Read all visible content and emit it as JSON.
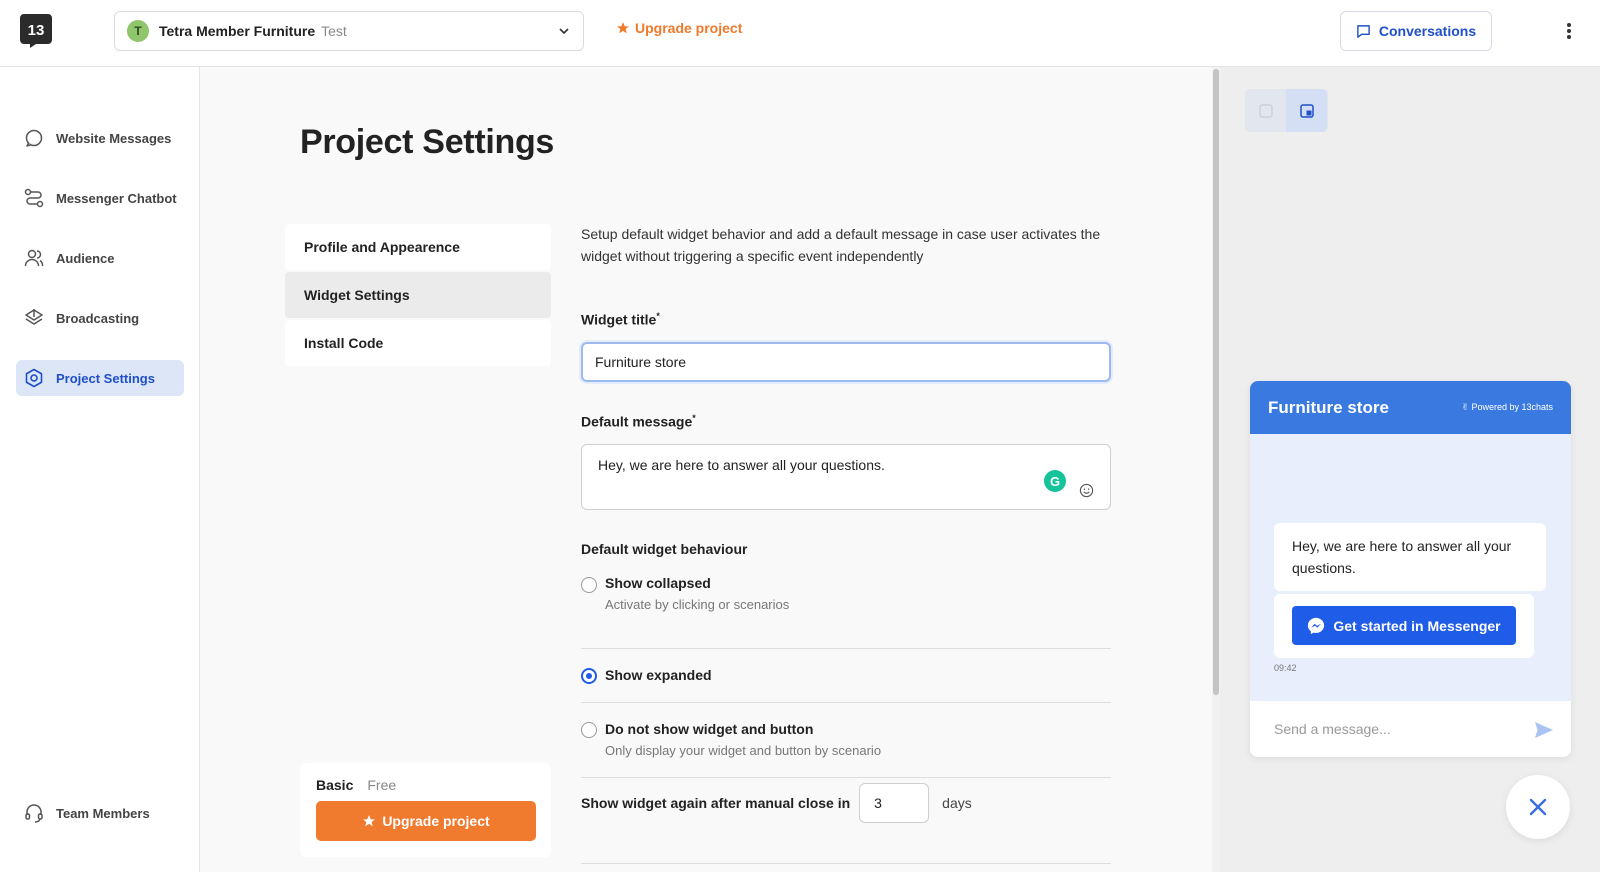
{
  "app": {
    "logo_text": "13"
  },
  "project": {
    "avatar_letter": "T",
    "name": "Tetra Member Furniture",
    "env": "Test"
  },
  "header": {
    "upgrade_label": "Upgrade project",
    "conversations_label": "Conversations"
  },
  "sidebar": {
    "items": [
      {
        "label": "Website Messages",
        "icon": "chat-bubble-icon"
      },
      {
        "label": "Messenger Chatbot",
        "icon": "flow-icon"
      },
      {
        "label": "Audience",
        "icon": "users-icon"
      },
      {
        "label": "Broadcasting",
        "icon": "layers-icon"
      },
      {
        "label": "Project Settings",
        "icon": "hexagon-settings-icon",
        "active": true
      }
    ],
    "team_members_label": "Team Members"
  },
  "main": {
    "title": "Project Settings",
    "subnav": [
      "Profile and Appearence",
      "Widget Settings",
      "Install Code"
    ],
    "description": "Setup default widget behavior and add a default message in case user activates the widget without triggering a specific event independently",
    "widget_title_label": "Widget title",
    "widget_title_value": "Furniture store",
    "default_message_label": "Default message",
    "default_message_value": "Hey, we are here to answer all your questions.",
    "behaviour_label": "Default widget behaviour",
    "options": [
      {
        "title": "Show collapsed",
        "subtitle": "Activate by clicking or scenarios",
        "checked": false
      },
      {
        "title": "Show expanded",
        "subtitle": "",
        "checked": true
      },
      {
        "title": "Do not show widget and button",
        "subtitle": "Only display your widget and button by scenario",
        "checked": false
      }
    ],
    "show_again_label": "Show widget again after manual close in",
    "show_again_value": "3",
    "show_again_unit": "days",
    "required_mark": "*"
  },
  "plan": {
    "name": "Basic",
    "tier": "Free",
    "upgrade_label": "Upgrade project"
  },
  "preview": {
    "widget_title": "Furniture store",
    "powered_by": "✌ Powered by 13chats",
    "message": "Hey, we are here to answer all your questions.",
    "messenger_button": "Get started in Messenger",
    "time": "09:42",
    "input_placeholder": "Send a message..."
  },
  "colors": {
    "brand_blue": "#1f5ce8",
    "accent_orange": "#f07a2e",
    "widget_header": "#3a7ae0"
  }
}
